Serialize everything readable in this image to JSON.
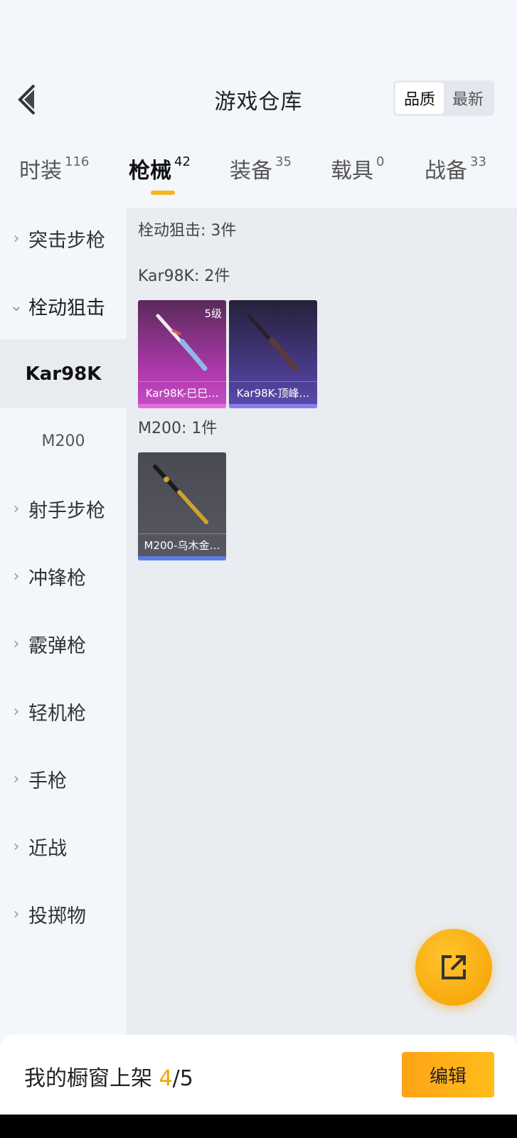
{
  "header": {
    "title": "游戏仓库",
    "sort_options": [
      "品质",
      "最新"
    ],
    "active_sort": "品质"
  },
  "tabs": [
    {
      "label": "时装",
      "count": "116"
    },
    {
      "label": "枪械",
      "count": "42"
    },
    {
      "label": "装备",
      "count": "35"
    },
    {
      "label": "载具",
      "count": "0"
    },
    {
      "label": "战备",
      "count": "33"
    }
  ],
  "active_tab": "枪械",
  "sidebar": {
    "categories": [
      {
        "label": "突击步枪"
      },
      {
        "label": "栓动狙击"
      },
      {
        "label": "射手步枪"
      },
      {
        "label": "冲锋枪"
      },
      {
        "label": "霰弹枪"
      },
      {
        "label": "轻机枪"
      },
      {
        "label": "手枪"
      },
      {
        "label": "近战"
      },
      {
        "label": "投掷物"
      }
    ],
    "subitems": [
      {
        "label": "Kar98K"
      },
      {
        "label": "M200"
      }
    ],
    "selected_sub": "Kar98K"
  },
  "content": {
    "category_title": "栓动狙击: 3件",
    "groups": [
      {
        "title": "Kar98K: 2件",
        "items": [
          {
            "name": "Kar98K-巳巳…",
            "badge": "5级",
            "color": "#c54fc4"
          },
          {
            "name": "Kar98K-顶峰…",
            "color": "#5a4cae"
          }
        ]
      },
      {
        "title": "M200: 1件",
        "items": [
          {
            "name": "M200-乌木金…",
            "color": "#585862"
          }
        ]
      }
    ]
  },
  "bottom": {
    "label": "我的橱窗上架",
    "current": "4",
    "sep_total": "/5",
    "edit_label": "编辑"
  },
  "colors": {
    "accent": "#f5b320",
    "edit_button": "#ffa317"
  }
}
